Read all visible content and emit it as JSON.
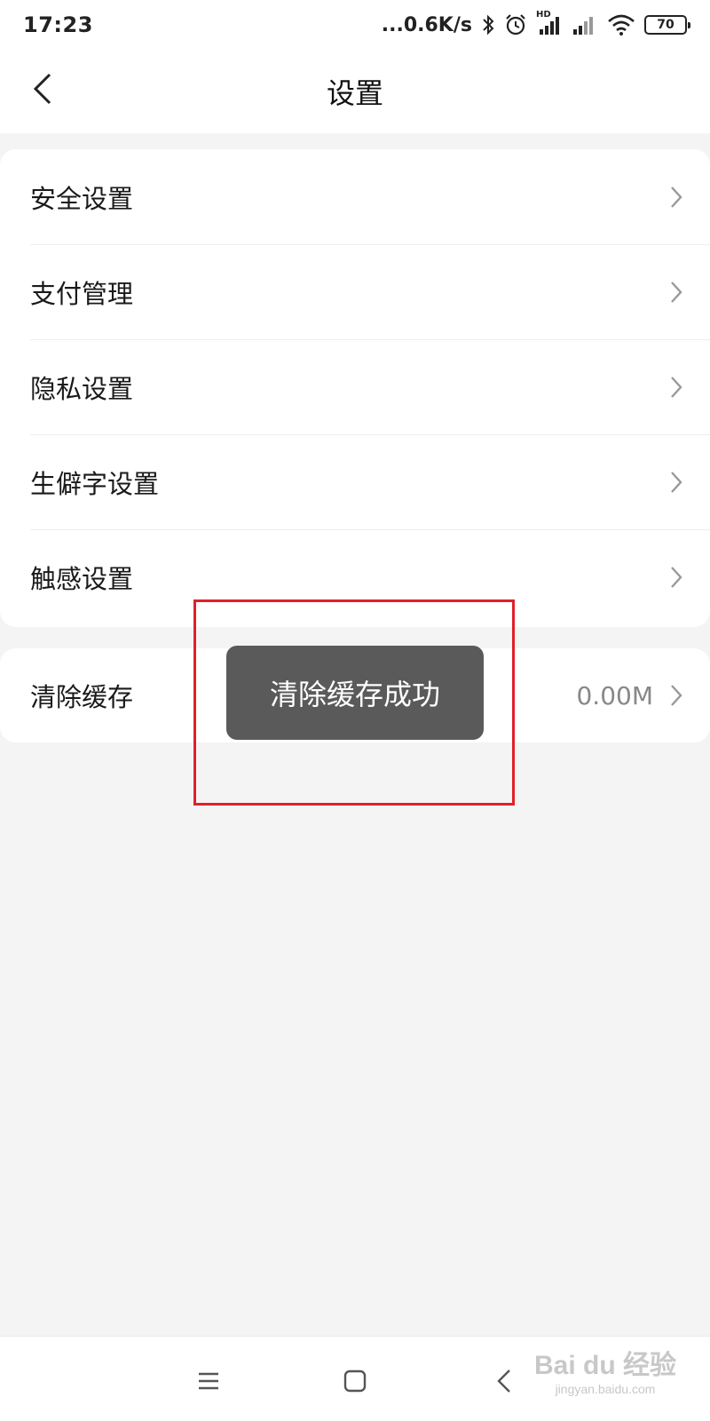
{
  "status_bar": {
    "time": "17:23",
    "net_speed": "...0.6K/s",
    "network_label": "HD",
    "battery": "70",
    "icons": [
      "bluetooth-icon",
      "alarm-icon",
      "signal-hd-icon",
      "signal-icon",
      "wifi-icon",
      "battery-icon"
    ]
  },
  "header": {
    "title": "设置",
    "back_icon": "chevron-left-icon"
  },
  "settings_group_1": [
    {
      "label": "安全设置"
    },
    {
      "label": "支付管理"
    },
    {
      "label": "隐私设置"
    },
    {
      "label": "生僻字设置"
    },
    {
      "label": "触感设置"
    }
  ],
  "settings_group_2": [
    {
      "label": "清除缓存",
      "value": "0.00M"
    }
  ],
  "toast": {
    "message": "清除缓存成功"
  },
  "annotation": {
    "color": "#e0202a"
  },
  "nav_bar": {
    "icons": [
      "menu-icon",
      "home-icon",
      "back-icon"
    ]
  },
  "watermark": {
    "logo": "Bai du 经验",
    "url": "jingyan.baidu.com"
  },
  "colors": {
    "background": "#f4f4f4",
    "card": "#ffffff",
    "toast_bg": "#5a5a5a",
    "value_text": "#888888"
  }
}
